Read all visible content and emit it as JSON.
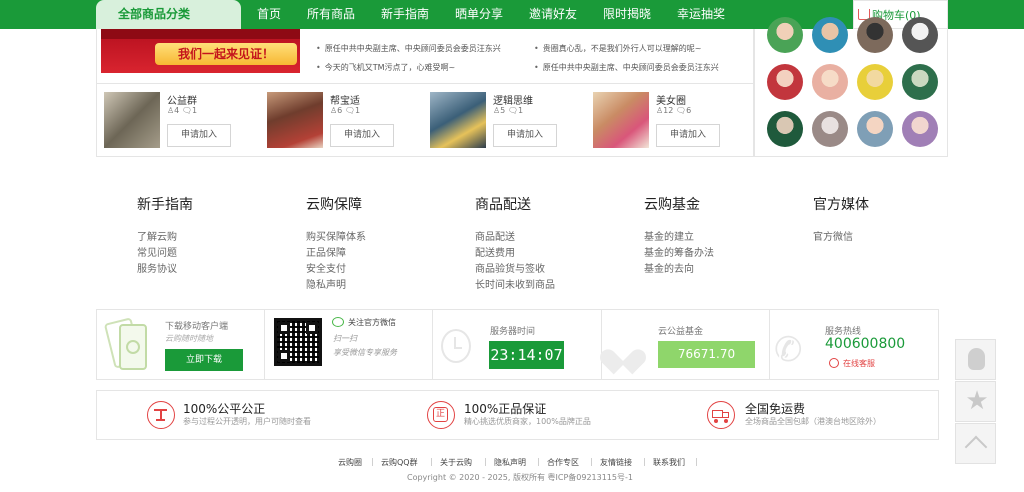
{
  "nav": {
    "category_label": "全部商品分类",
    "items": [
      "首页",
      "所有商品",
      "新手指南",
      "晒单分享",
      "邀请好友",
      "限时揭晓",
      "幸运抽奖"
    ],
    "cart_label": "购物车(0)"
  },
  "banner": {
    "text": "我们一起来见证！"
  },
  "news": [
    "原任中共中央副主席、中央顾问委员会委员汪东兴",
    "今天的飞机又TM污点了，心难受啊~",
    "贵圈真心乱，不是我们外行人可以理解的呢~",
    "原任中共中央副主席、中央顾问委员会委员汪东兴"
  ],
  "groups": [
    {
      "name": "公益群",
      "members": "4",
      "posts": "1",
      "join": "申请加入"
    },
    {
      "name": "帮宝适",
      "members": "6",
      "posts": "1",
      "join": "申请加入"
    },
    {
      "name": "逻辑思维",
      "members": "5",
      "posts": "1",
      "join": "申请加入"
    },
    {
      "name": "美女圈",
      "members": "12",
      "posts": "6",
      "join": "申请加入"
    }
  ],
  "footer_columns": [
    {
      "title": "新手指南",
      "links": [
        "了解云购",
        "常见问题",
        "服务协议"
      ]
    },
    {
      "title": "云购保障",
      "links": [
        "购买保障体系",
        "正品保障",
        "安全支付",
        "隐私声明"
      ]
    },
    {
      "title": "商品配送",
      "links": [
        "商品配送",
        "配送费用",
        "商品验货与签收",
        "长时间未收到商品"
      ]
    },
    {
      "title": "云购基金",
      "links": [
        "基金的建立",
        "基金的筹备办法",
        "基金的去向"
      ]
    },
    {
      "title": "官方媒体",
      "links": [
        "官方微信"
      ]
    }
  ],
  "info": {
    "app_title": "下载移动客户端",
    "app_slogan": "云购随时随地",
    "download_label": "立即下载",
    "wechat_title": "关注官方微信",
    "wechat_hint_1": "扫一扫",
    "wechat_hint_2": "享受微信专享服务",
    "server_time_label": "服务器时间",
    "server_time": "23:14:07",
    "fund_label": "云公益基金",
    "fund_value": "76671.70",
    "hotline_label": "服务热线",
    "hotline": "400600800",
    "online_service": "在线客服"
  },
  "guarantees": [
    {
      "title": "100%公平公正",
      "sub": "参与过程公开透明，用户可随时查看"
    },
    {
      "title": "100%正品保证",
      "sub": "精心挑选优质商家，100%品牌正品"
    },
    {
      "title": "全国免运费",
      "sub": "全场商品全国包邮（港澳台地区除外）"
    }
  ],
  "footer_links": [
    "云购圈",
    "云购QQ群",
    "关于云购",
    "隐私声明",
    "合作专区",
    "友情链接",
    "联系我们"
  ],
  "copyright": "Copyright © 2020 - 2025, 版权所有 粤ICP备09213115号-1",
  "colors": {
    "brand_green": "#1a9a39",
    "accent_red": "#e24343",
    "fund_green": "#8fd66b"
  }
}
